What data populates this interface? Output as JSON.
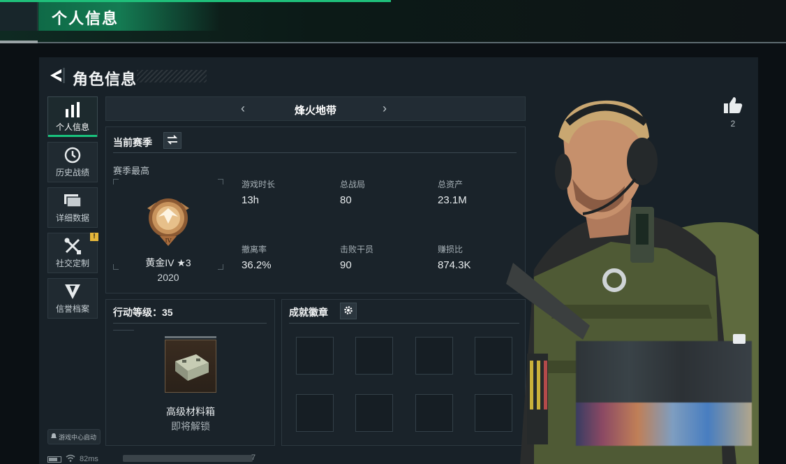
{
  "header": {
    "title": "个人信息"
  },
  "panel": {
    "title": "角色信息"
  },
  "nav": [
    {
      "label": "个人信息",
      "icon": "bar-chart-icon",
      "active": true
    },
    {
      "label": "历史战绩",
      "icon": "clock-history-icon",
      "active": false
    },
    {
      "label": "详细数据",
      "icon": "folder-icon",
      "active": false
    },
    {
      "label": "社交定制",
      "icon": "tools-icon",
      "active": false,
      "alert": "!"
    },
    {
      "label": "信誉档案",
      "icon": "shield-emblem-icon",
      "active": false
    }
  ],
  "launcher": {
    "label": "游戏中心启动"
  },
  "map_selector": {
    "name": "烽火地带",
    "prev": "‹",
    "next": "›"
  },
  "season": {
    "header": "当前赛季",
    "best_label": "赛季最高",
    "rank": "黄金IV ★3",
    "year": "2020",
    "stats": [
      {
        "label": "游戏时长",
        "value": "13h"
      },
      {
        "label": "总战局",
        "value": "80"
      },
      {
        "label": "总资产",
        "value": "23.1M"
      },
      {
        "label": "撤离率",
        "value": "36.2%"
      },
      {
        "label": "击败干员",
        "value": "90"
      },
      {
        "label": "赚损比",
        "value": "874.3K"
      }
    ]
  },
  "level": {
    "title": "行动等级：35",
    "reward_name": "高级材料箱",
    "reward_state": "即将解锁"
  },
  "badges": {
    "title": "成就徽章",
    "slots": 8
  },
  "likes": {
    "count": "2"
  },
  "status_bar": {
    "ping": "82ms",
    "tail": "7"
  },
  "colors": {
    "accent_green": "#19c27d",
    "alert_yellow": "#e6b73a",
    "panel_bg": "#182128"
  }
}
